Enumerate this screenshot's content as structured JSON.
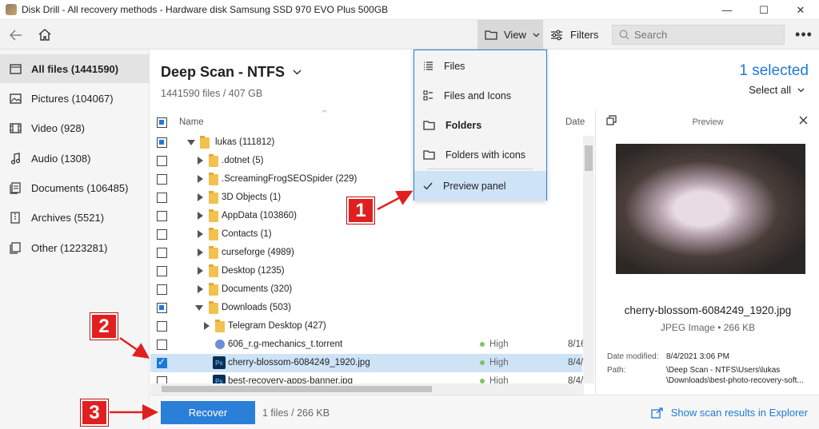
{
  "window": {
    "title": "Disk Drill - All recovery methods - Hardware disk Samsung SSD 970 EVO Plus 500GB"
  },
  "toolbar": {
    "view_label": "View",
    "filters_label": "Filters",
    "search_placeholder": "Search"
  },
  "sidebar": {
    "items": [
      {
        "label": "All files (1441590)",
        "icon": "file-icon"
      },
      {
        "label": "Pictures (104067)",
        "icon": "picture-icon"
      },
      {
        "label": "Video (928)",
        "icon": "video-icon"
      },
      {
        "label": "Audio (1308)",
        "icon": "audio-icon"
      },
      {
        "label": "Documents (106485)",
        "icon": "document-icon"
      },
      {
        "label": "Archives (5521)",
        "icon": "archive-icon"
      },
      {
        "label": "Other (1223281)",
        "icon": "other-icon"
      }
    ]
  },
  "main": {
    "title": "Deep Scan - NTFS",
    "subtitle": "1441590 files / 407 GB",
    "selected_count": "1 selected",
    "select_all": "Select all"
  },
  "table": {
    "col_name": "Name",
    "col_date": "Date",
    "rows": [
      {
        "name": "lukas (111812)",
        "status": "",
        "date": ""
      },
      {
        "name": ".dotnet (5)",
        "status": "",
        "date": ""
      },
      {
        "name": ".ScreamingFrogSEOSpider (229)",
        "status": "",
        "date": ""
      },
      {
        "name": "3D Objects (1)",
        "status": "",
        "date": ""
      },
      {
        "name": "AppData (103860)",
        "status": "",
        "date": ""
      },
      {
        "name": "Contacts (1)",
        "status": "",
        "date": ""
      },
      {
        "name": "curseforge (4989)",
        "status": "",
        "date": ""
      },
      {
        "name": "Desktop (1235)",
        "status": "",
        "date": ""
      },
      {
        "name": "Documents (320)",
        "status": "",
        "date": ""
      },
      {
        "name": "Downloads (503)",
        "status": "",
        "date": ""
      },
      {
        "name": "Telegram Desktop (427)",
        "status": "",
        "date": ""
      },
      {
        "name": "606_r.g-mechanics_t.torrent",
        "status": "High",
        "date": "8/16"
      },
      {
        "name": "cherry-blossom-6084249_1920.jpg",
        "status": "High",
        "date": "8/4/"
      },
      {
        "name": "best-recovery-apps-banner.jpg",
        "status": "High",
        "date": "8/4/"
      }
    ]
  },
  "view_menu": {
    "items": [
      {
        "label": "Files"
      },
      {
        "label": "Files and Icons"
      },
      {
        "label": "Folders"
      },
      {
        "label": "Folders with icons"
      },
      {
        "label": "Preview panel"
      }
    ]
  },
  "preview": {
    "title": "Preview",
    "file_name": "cherry-blossom-6084249_1920.jpg",
    "file_type": "JPEG Image • 266 KB",
    "date_modified_label": "Date modified:",
    "date_modified_value": "8/4/2021 3:06 PM",
    "path_label": "Path:",
    "path_line1": "\\Deep Scan - NTFS\\Users\\lukas",
    "path_line2": "\\Downloads\\best-photo-recovery-soft..."
  },
  "bottom": {
    "recover_label": "Recover",
    "info": "1 files / 266 KB",
    "explorer_link": "Show scan results in Explorer"
  },
  "annotations": {
    "badge1": "1",
    "badge2": "2",
    "badge3": "3"
  },
  "colors": {
    "accent": "#2b7fd8",
    "annotation": "#e02020",
    "selection": "#cfe3f7"
  }
}
